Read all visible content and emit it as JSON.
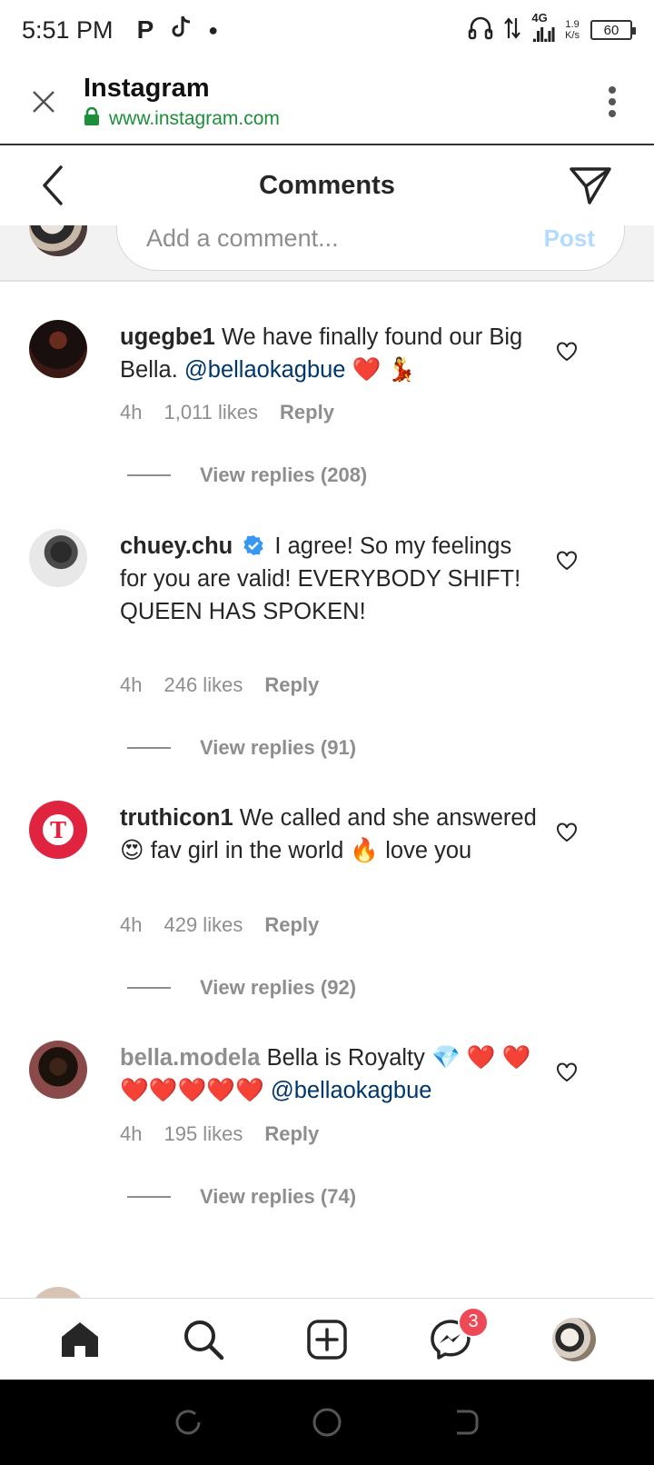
{
  "status_bar": {
    "time": "5:51 PM",
    "network_label": "4G",
    "net_speed_value": "1.9",
    "net_speed_unit": "K/s",
    "battery": "60"
  },
  "browser": {
    "title": "Instagram",
    "url": "www.instagram.com"
  },
  "header": {
    "title": "Comments"
  },
  "add_comment": {
    "placeholder": "Add a comment...",
    "post_label": "Post"
  },
  "comments": [
    {
      "username": "ugegbe1",
      "text": "We have finally found our Big Bella.",
      "mention": "@bellaokagbue",
      "emojis": "❤️ 💃",
      "time": "4h",
      "likes": "1,011 likes",
      "reply_label": "Reply",
      "view_replies": "View replies (208)"
    },
    {
      "username": "chuey.chu",
      "verified": true,
      "text": "I agree! So my feelings for you are valid! EVERYBODY SHIFT! QUEEN HAS SPOKEN!",
      "time": "4h",
      "likes": "246 likes",
      "reply_label": "Reply",
      "view_replies": "View replies (91)"
    },
    {
      "username": "truthicon1",
      "text_part1": "We called and she answered",
      "emoji1": "😍",
      "text_part2": "fav girl in the world",
      "emoji2": "🔥",
      "text_part3": "love you",
      "time": "4h",
      "likes": "429 likes",
      "reply_label": "Reply",
      "view_replies": "View replies (92)"
    },
    {
      "username": "bella.modela",
      "text": "Bella is Royalty",
      "emoji_gem": "💎",
      "hearts": "❤️ ❤️❤️❤️❤️❤️❤️",
      "mention": "@bellaokagbue",
      "time": "4h",
      "likes": "195 likes",
      "reply_label": "Reply",
      "view_replies": "View replies (74)"
    }
  ],
  "bottom_nav": {
    "messages_badge": "3"
  },
  "colors": {
    "accent_link": "#00376b",
    "secure_green": "#1b8f3a",
    "badge_red": "#ed4956",
    "muted_text": "#8e8e8e"
  }
}
